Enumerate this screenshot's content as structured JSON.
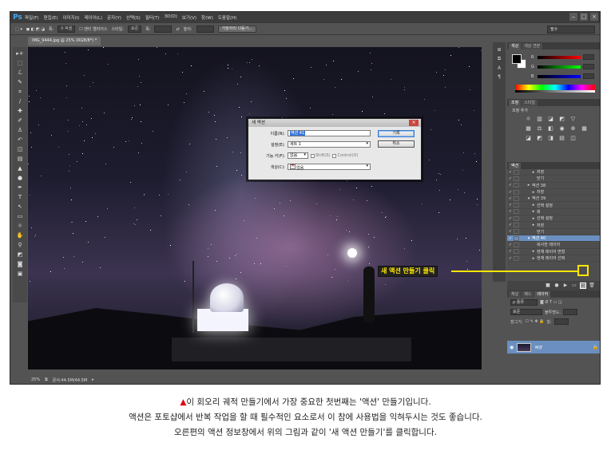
{
  "app": {
    "logo": "Ps",
    "menu": [
      "파일(F)",
      "편집(E)",
      "이미지(I)",
      "레이어(L)",
      "문자(Y)",
      "선택(S)",
      "필터(T)",
      "3D(D)",
      "보기(V)",
      "창(W)",
      "도움말(H)"
    ],
    "window_controls": [
      "‒",
      "□",
      "×"
    ],
    "workspace": "필수"
  },
  "options_bar": {
    "width_label": "폭:",
    "width_value": "0 픽셀",
    "antialias": "앤티 앨리어스",
    "style_label": "스타일:",
    "style_value": "표준",
    "w_label": "폭:",
    "h_label": "높이:",
    "refine_button": "가장자리 다듬기..."
  },
  "document": {
    "tab": "IMG_9444.jpg @ 25% (RGB/8*) *",
    "zoom": "25%",
    "doc_size": "문서:44.5M/44.5M"
  },
  "dialog": {
    "title": "새 액션",
    "name_label": "이름(N):",
    "name_value": "액션 41",
    "set_label": "설정(E):",
    "set_value": "세트 1",
    "fkey_label": "기능 키(F):",
    "fkey_value": "없음",
    "shift_label": "Shift(S)",
    "control_label": "Control(O)",
    "color_label": "색상(C):",
    "color_value": "없음",
    "record_button": "기록",
    "cancel_button": "취소",
    "close": "×"
  },
  "panels": {
    "color_tabs": [
      "색상",
      "색상 견본"
    ],
    "channels": [
      "R",
      "G",
      "B"
    ],
    "adjust_tabs": [
      "조정",
      "스타일"
    ],
    "adjust_title": "조정 추가",
    "actions_tabs": [
      "액션"
    ],
    "actions": [
      {
        "label": "저장",
        "indent": 2,
        "expand": "▸",
        "selected": false
      },
      {
        "label": "닫기",
        "indent": 2,
        "expand": "",
        "selected": false
      },
      {
        "label": "액션 38",
        "indent": 1,
        "expand": "▸",
        "selected": false
      },
      {
        "label": "저장",
        "indent": 2,
        "expand": "▸",
        "selected": false
      },
      {
        "label": "액션 39",
        "indent": 1,
        "expand": "▾",
        "selected": false
      },
      {
        "label": "선택 설정",
        "indent": 2,
        "expand": "▸",
        "selected": false
      },
      {
        "label": "회",
        "indent": 2,
        "expand": "▸",
        "selected": false
      },
      {
        "label": "선택 설정",
        "indent": 2,
        "expand": "▸",
        "selected": false
      },
      {
        "label": "저장",
        "indent": 2,
        "expand": "▸",
        "selected": false
      },
      {
        "label": "닫기",
        "indent": 2,
        "expand": "",
        "selected": false
      },
      {
        "label": "액션 40",
        "indent": 1,
        "expand": "▾",
        "selected": true
      },
      {
        "label": "복사한 레이어",
        "indent": 2,
        "expand": "",
        "selected": false
      },
      {
        "label": "현재 레이어 변형",
        "indent": 2,
        "expand": "▸",
        "selected": false
      },
      {
        "label": "현재 레이어 선택",
        "indent": 2,
        "expand": "▸",
        "selected": false
      }
    ],
    "layers_tabs": [
      "레이어",
      "채널",
      "패스"
    ],
    "layers_kind": "종류",
    "layers_blend": "표준",
    "layers_opacity_label": "불투명도:",
    "layers_lock_label": "잠그기:",
    "layers_fill_label": "칠:",
    "layer_name": "배경"
  },
  "callout": {
    "text": "새 액션 만들기 클릭",
    "color": "#ffe600"
  },
  "caption": {
    "marker": "▲",
    "line1": "이 회오리 궤적 만들기에서 가장 중요한 첫번째는 '액션' 만들기입니다.",
    "line2": "액션은 포토샵에서 반복 작업을 할 때 필수적인 요소로서 이 참에 사용법을 익혀두시는 것도 좋습니다.",
    "line3": "오른편의 액션 정보창에서 위의 그림과 같이 '새 액션 만들기'를 클릭합니다."
  }
}
